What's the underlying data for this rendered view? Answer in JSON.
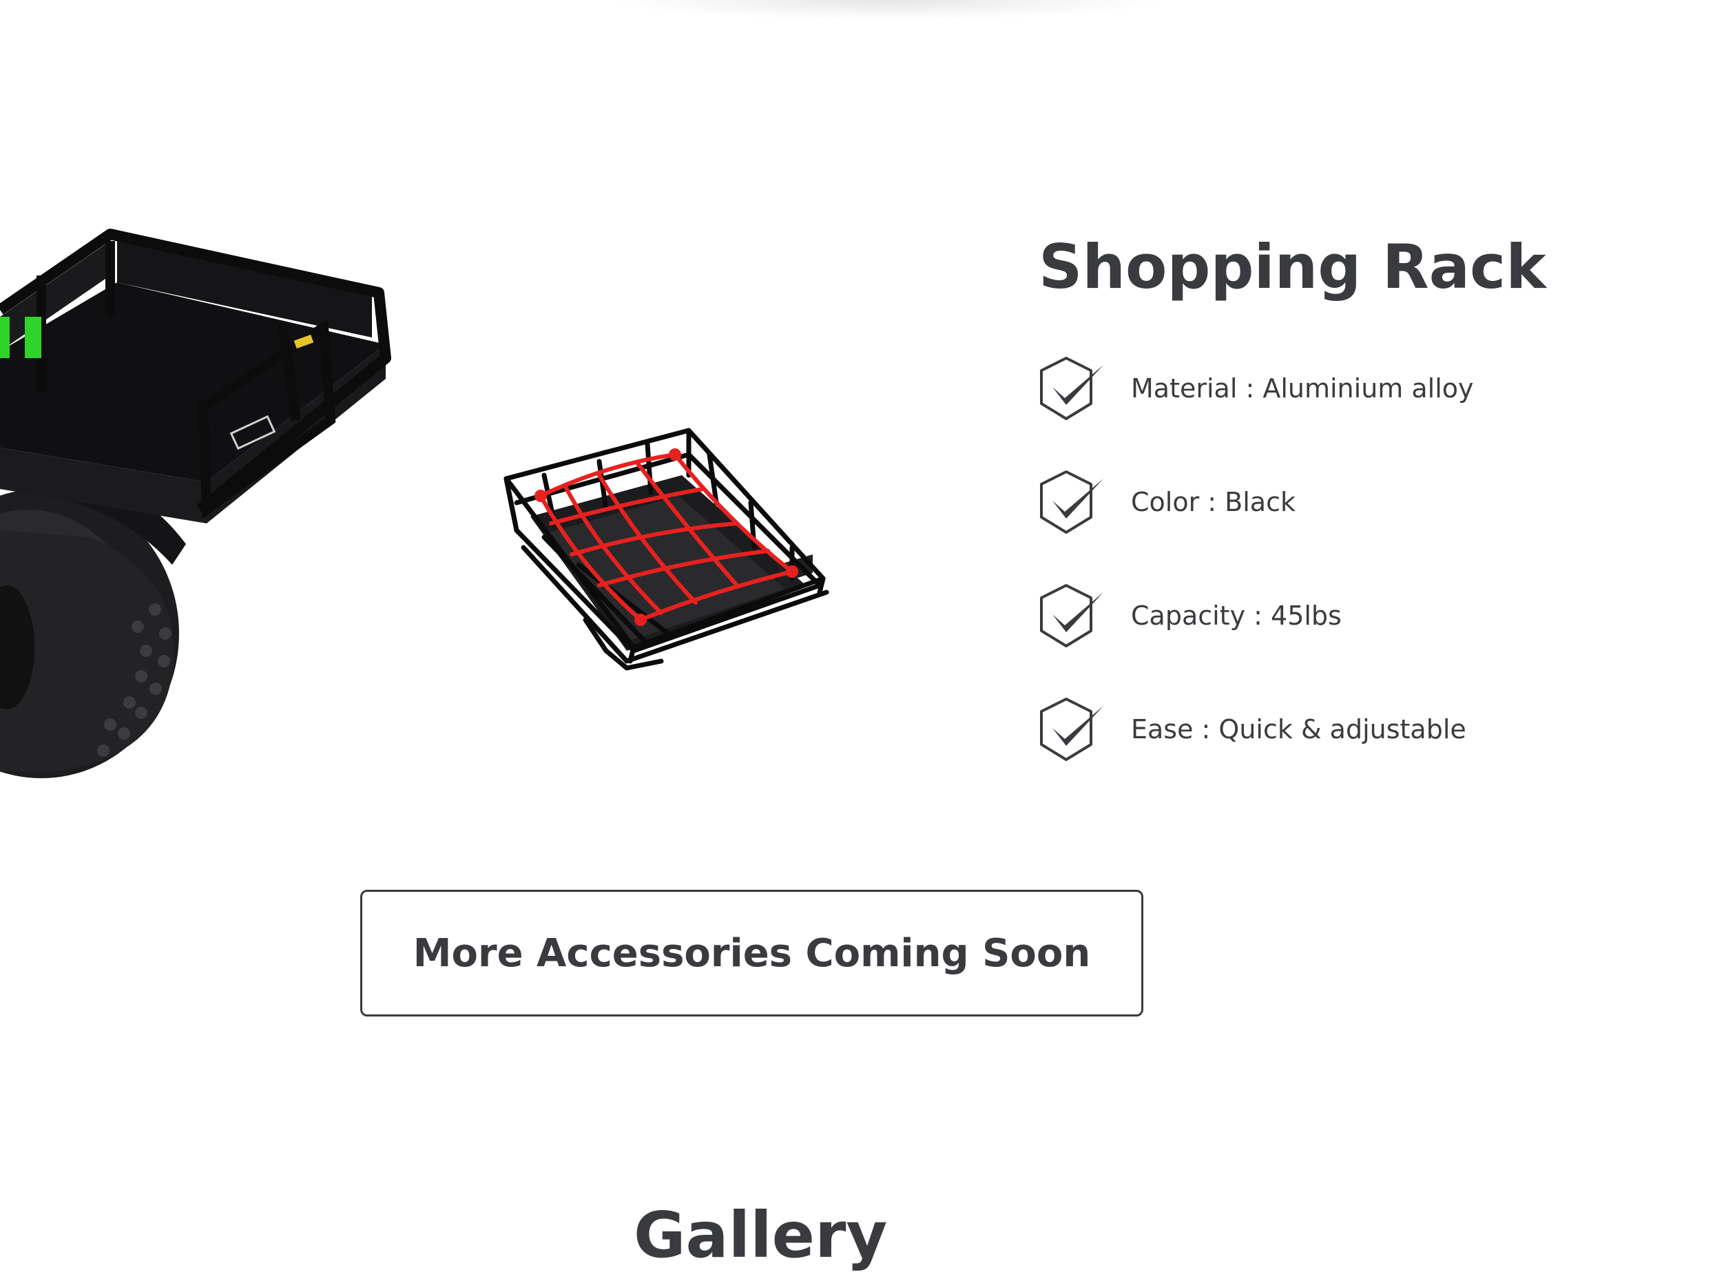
{
  "product": {
    "title": "Shopping Rack",
    "image_alt": "Black metal shopping rack basket with red cargo net mounted on scooter",
    "features": [
      {
        "icon": "check-badge-icon",
        "text": "Material : Aluminium alloy"
      },
      {
        "icon": "check-badge-icon",
        "text": "Color : Black"
      },
      {
        "icon": "check-badge-icon",
        "text": "Capacity : 45lbs"
      },
      {
        "icon": "check-badge-icon",
        "text": "Ease : Quick & adjustable"
      }
    ]
  },
  "cta": {
    "label": "More Accessories Coming Soon"
  },
  "gallery": {
    "heading": "Gallery"
  },
  "colors": {
    "text": "#3a3b3e",
    "background": "#ffffff",
    "net": "#e8211f",
    "accent_green": "#2fd32a"
  }
}
